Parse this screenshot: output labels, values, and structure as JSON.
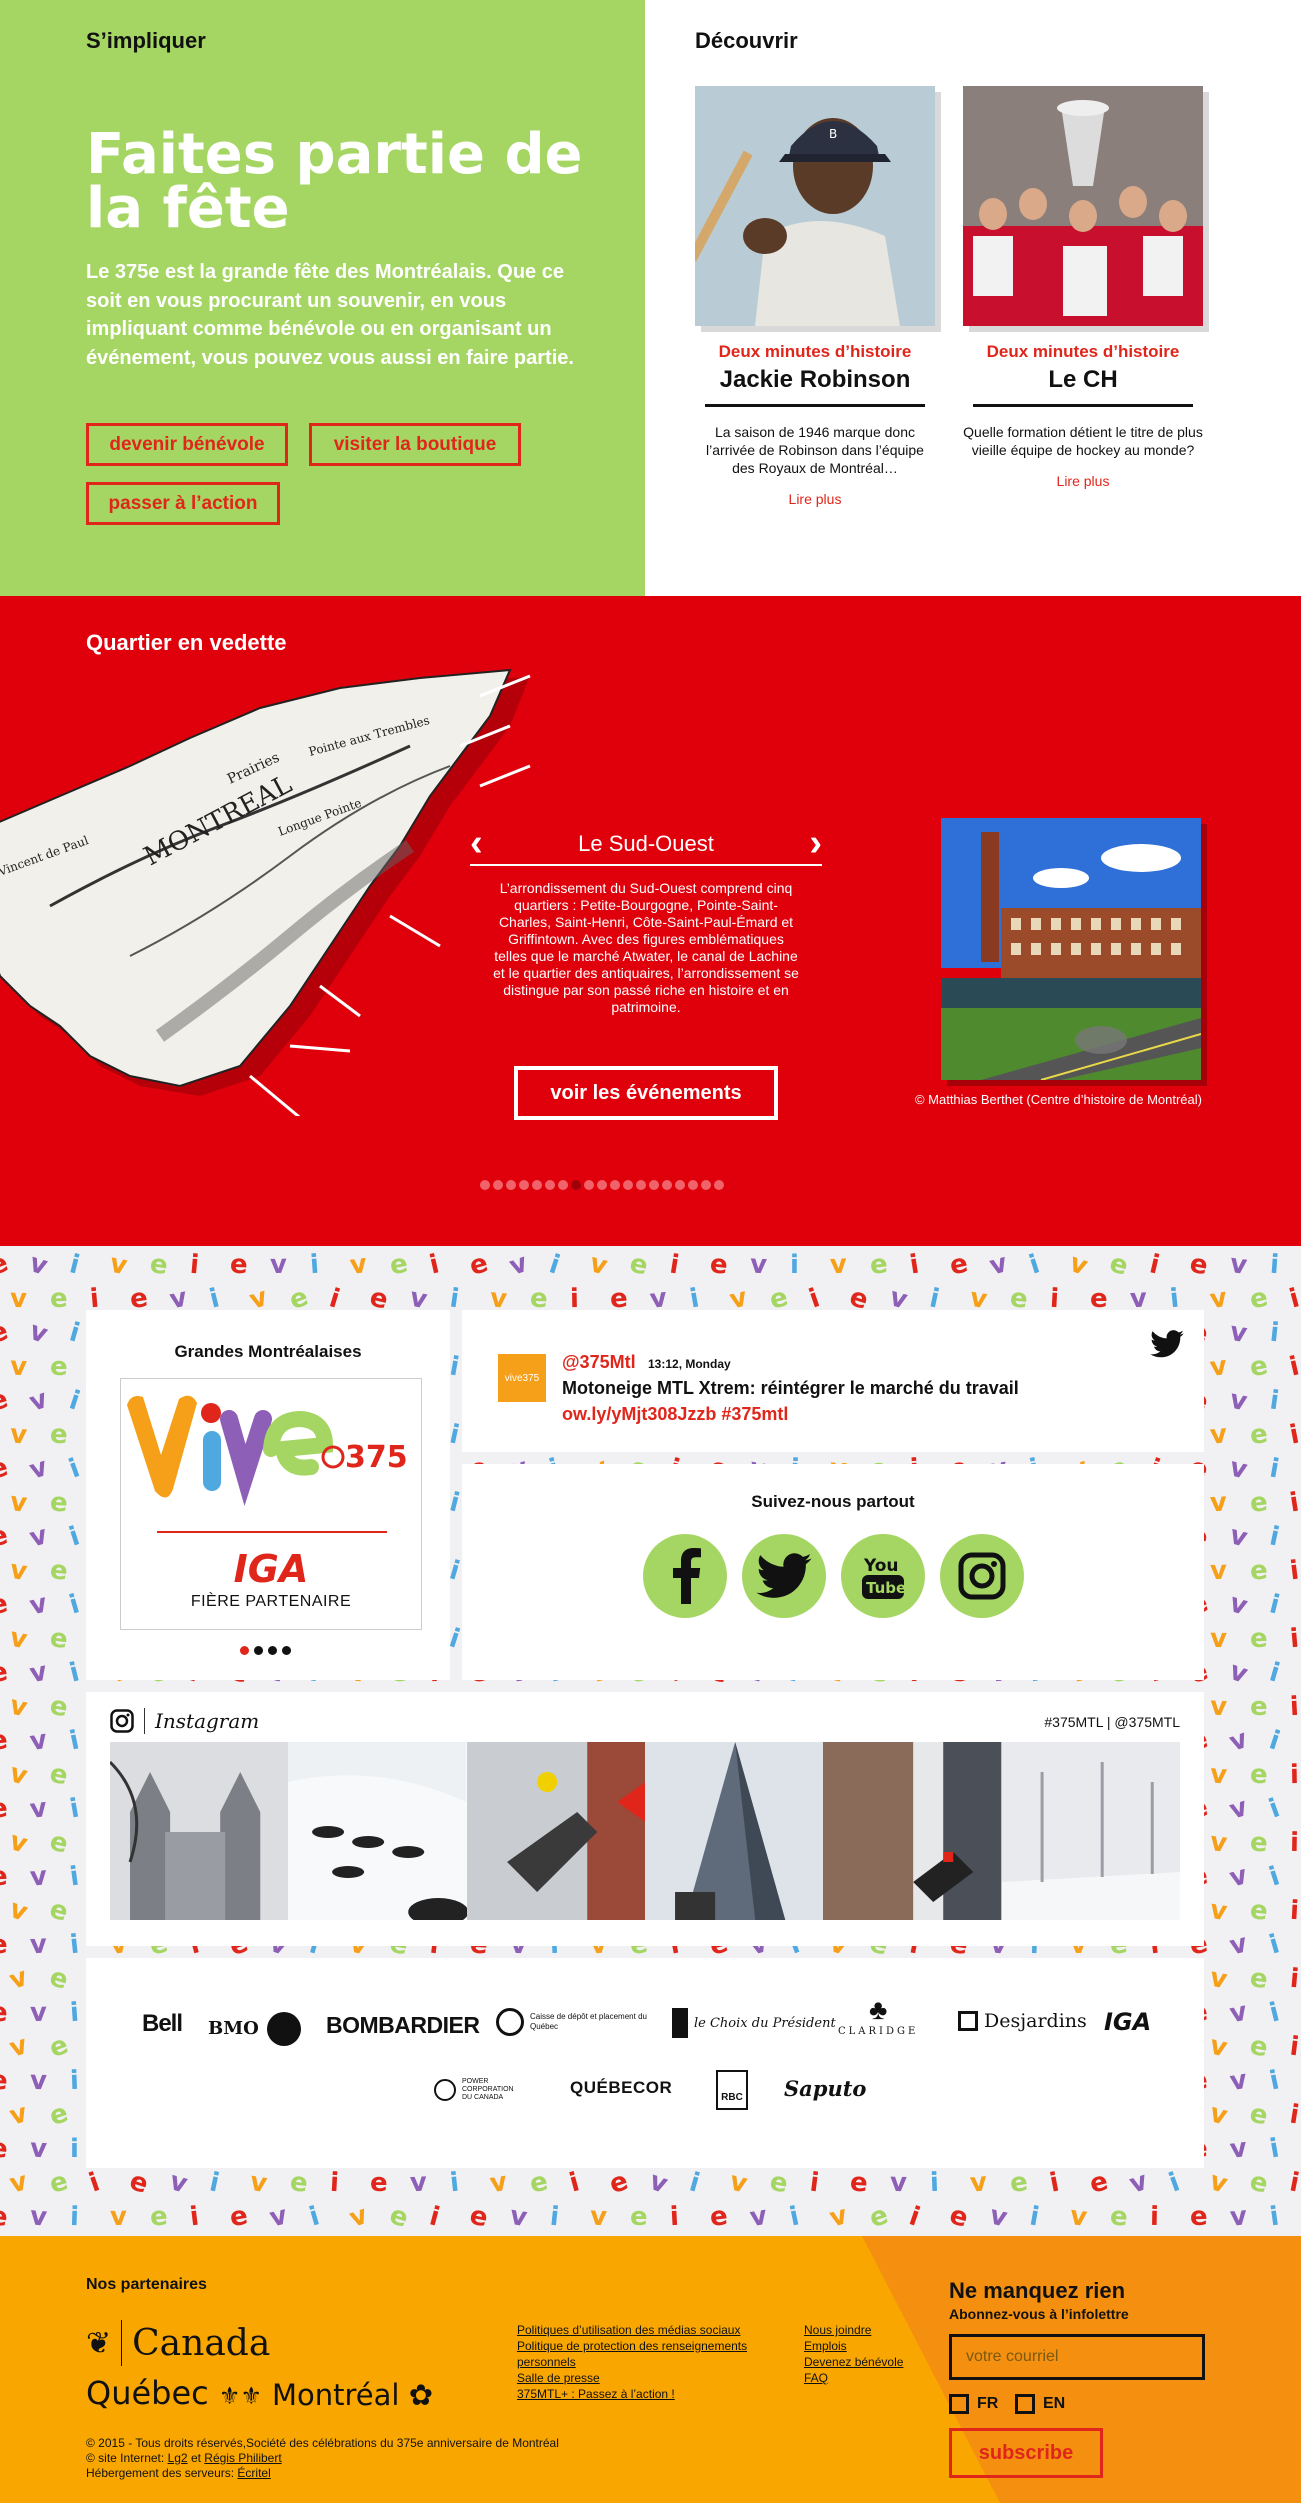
{
  "involve": {
    "label": "S’impliquer",
    "title": "Faites partie de la fête",
    "text": "Le 375e est la grande fête des Montréalais. Que ce soit en vous procurant un souvenir, en vous impliquant comme bénévole ou en organisant un événement, vous pouvez vous aussi en faire partie.",
    "buttons": [
      "devenir bénévole",
      "visiter la boutique",
      "passer à l’action"
    ]
  },
  "discover": {
    "label": "Découvrir",
    "cards": [
      {
        "kicker": "Deux minutes d’histoire",
        "title": "Jackie Robinson",
        "desc": "La saison de 1946 marque donc l’arrivée de Robinson dans l’équipe des Royaux de Montréal…",
        "more": "Lire plus"
      },
      {
        "kicker": "Deux minutes d’histoire",
        "title": "Le CH",
        "desc": "Quelle formation détient le titre de plus vieille équipe de hockey au monde?",
        "more": "Lire plus"
      }
    ]
  },
  "featured": {
    "label": "Quartier en vedette",
    "name": "Le Sud-Ouest",
    "text": "L’arrondissement du Sud-Ouest comprend cinq quartiers : Petite-Bourgogne, Pointe-Saint-Charles, Saint-Henri, Côte-Saint-Paul-Émard et Griffintown. Avec des figures emblématiques telles que le marché Atwater, le canal de Lachine et le quartier des antiquaires, l’arrondissement se distingue par son passé riche en histoire et en patrimoine.",
    "button": "voir les événements",
    "credit": "© Matthias Berthet (Centre d’histoire de Montréal)",
    "dot_count": 19,
    "active_dot": 7
  },
  "grandes": {
    "title": "Grandes Montréalaises",
    "partner_logo": "IGA",
    "partner_tag": "FIÈRE PARTENAIRE",
    "vive_text": "vive",
    "vive_num": "375"
  },
  "tweet": {
    "avatar": "vive375",
    "handle": "@375Mtl",
    "time": "13:12, Monday",
    "text": "Motoneige MTL Xtrem: réintégrer le marché du travail",
    "link": "ow.ly/yMjt308Jzzb #375mtl"
  },
  "follow": {
    "title": "Suivez-nous partout"
  },
  "instagram": {
    "brand": "Instagram",
    "tags": "#375MTL | @375MTL"
  },
  "sponsors": {
    "row1": [
      "Bell",
      "BMO",
      "BOMBARDIER",
      "Caisse de dépôt et placement du Québec",
      "le Choix du Président",
      "CLARIDGE",
      "Desjardins",
      "IGA"
    ],
    "row2": [
      "POWER CORPORATION DU CANADA",
      "QUÉBECOR",
      "RBC",
      "Saputo"
    ]
  },
  "footer": {
    "partners_label": "Nos partenaires",
    "canada": "Canada",
    "quebec": "Québec",
    "montreal": "Montréal",
    "links_col1": [
      "Politiques d’utilisation des médias sociaux",
      "Politique de protection des renseignements personnels",
      "Salle de presse",
      "375MTL+ : Passez à l’action !"
    ],
    "links_col2": [
      "Nous joindre",
      "Emplois",
      "Devenez bénévole",
      "FAQ"
    ],
    "copyright": "© 2015 - Tous droits réservés,Société des célébrations du 375e anniversaire de Montréal",
    "site_prefix": "© site Internet:",
    "site_a": "Lg2",
    "site_and": "et",
    "site_b": "Régis Philibert",
    "hosting_prefix": "Hébergement des serveurs:",
    "hosting": "Écritel",
    "newsletter_title": "Ne manquez rien",
    "newsletter_sub": "Abonnez-vous à l’infolettre",
    "email_placeholder": "votre courriel",
    "lang_fr": "FR",
    "lang_en": "EN",
    "subscribe": "subscribe"
  }
}
